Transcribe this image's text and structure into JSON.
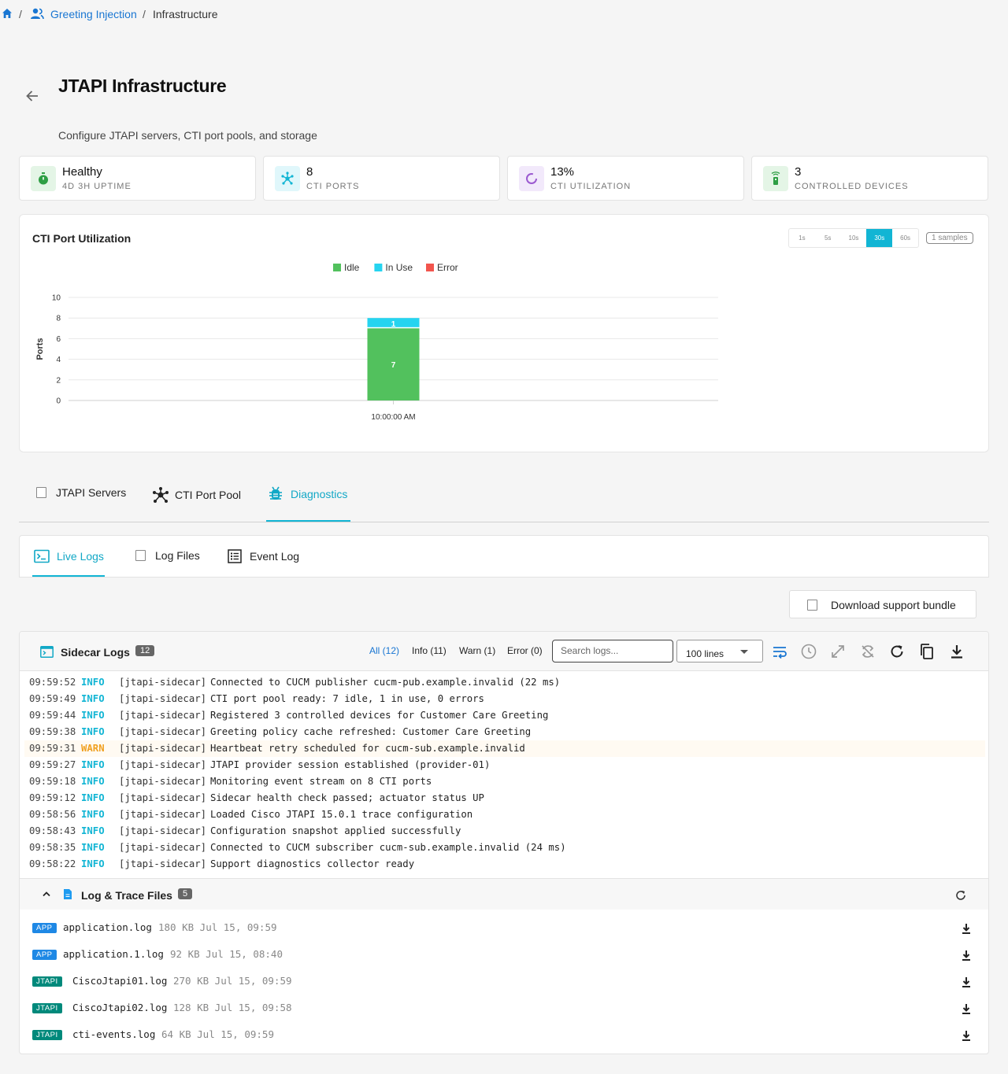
{
  "breadcrumb": {
    "parent": "Greeting Injection",
    "separator": "/",
    "current": "Infrastructure"
  },
  "header": {
    "title": "JTAPI Infrastructure",
    "subtitle": "Configure JTAPI servers, CTI port pools, and storage"
  },
  "stats": [
    {
      "value": "Healthy",
      "label": "4D 3H UPTIME",
      "icon": "stopwatch-icon",
      "color": "#2e9e44"
    },
    {
      "value": "8",
      "label": "CTI PORTS",
      "icon": "hub-icon",
      "color": "#12b5d4"
    },
    {
      "value": "13%",
      "label": "CTI UTILIZATION",
      "icon": "donut-icon",
      "color": "#9b59d0"
    },
    {
      "value": "3",
      "label": "CONTROLLED DEVICES",
      "icon": "phone-signal-icon",
      "color": "#2e9e44"
    }
  ],
  "chart_panel": {
    "title": "CTI Port Utilization",
    "intervals": [
      "1s",
      "5s",
      "10s",
      "30s",
      "60s"
    ],
    "active_interval": "30s",
    "samples": "1 samples"
  },
  "chart_data": {
    "type": "bar",
    "stacked": true,
    "categories": [
      "10:00:00 AM"
    ],
    "series": [
      {
        "name": "Idle",
        "values": [
          7
        ],
        "color": "#52c15d"
      },
      {
        "name": "In Use",
        "values": [
          1
        ],
        "color": "#26d4f0"
      },
      {
        "name": "Error",
        "values": [
          0
        ],
        "color": "#f2554d"
      }
    ],
    "ylabel": "Ports",
    "ylim": [
      0,
      10
    ],
    "yticks": [
      0,
      2,
      4,
      6,
      8,
      10
    ],
    "legend": "top-center",
    "grid": true
  },
  "tabs": [
    {
      "label": "JTAPI Servers",
      "active": false
    },
    {
      "label": "CTI Port Pool",
      "active": false
    },
    {
      "label": "Diagnostics",
      "active": true
    }
  ],
  "subtabs": [
    {
      "label": "Live Logs",
      "active": true
    },
    {
      "label": "Log Files",
      "active": false
    },
    {
      "label": "Event Log",
      "active": false
    }
  ],
  "support_button": "Download support bundle",
  "logs": {
    "title": "Sidecar Logs",
    "count": "12",
    "filters": [
      {
        "label": "All (12)",
        "active": true
      },
      {
        "label": "Info (11)",
        "active": false
      },
      {
        "label": "Warn (1)",
        "active": false
      },
      {
        "label": "Error (0)",
        "active": false
      }
    ],
    "search_placeholder": "Search logs...",
    "lines_select": "100 lines",
    "entries": [
      {
        "time": "09:59:52",
        "level": "INFO",
        "source": "[jtapi-sidecar]",
        "message": "Connected to CUCM publisher cucm-pub.example.invalid (22 ms)"
      },
      {
        "time": "09:59:49",
        "level": "INFO",
        "source": "[jtapi-sidecar]",
        "message": "CTI port pool ready: 7 idle, 1 in use, 0 errors"
      },
      {
        "time": "09:59:44",
        "level": "INFO",
        "source": "[jtapi-sidecar]",
        "message": "Registered 3 controlled devices for Customer Care Greeting"
      },
      {
        "time": "09:59:38",
        "level": "INFO",
        "source": "[jtapi-sidecar]",
        "message": "Greeting policy cache refreshed: Customer Care Greeting"
      },
      {
        "time": "09:59:31",
        "level": "WARN",
        "source": "[jtapi-sidecar]",
        "message": "Heartbeat retry scheduled for cucm-sub.example.invalid"
      },
      {
        "time": "09:59:27",
        "level": "INFO",
        "source": "[jtapi-sidecar]",
        "message": "JTAPI provider session established (provider-01)"
      },
      {
        "time": "09:59:18",
        "level": "INFO",
        "source": "[jtapi-sidecar]",
        "message": "Monitoring event stream on 8 CTI ports"
      },
      {
        "time": "09:59:12",
        "level": "INFO",
        "source": "[jtapi-sidecar]",
        "message": "Sidecar health check passed; actuator status UP"
      },
      {
        "time": "09:58:56",
        "level": "INFO",
        "source": "[jtapi-sidecar]",
        "message": "Loaded Cisco JTAPI 15.0.1 trace configuration"
      },
      {
        "time": "09:58:43",
        "level": "INFO",
        "source": "[jtapi-sidecar]",
        "message": "Configuration snapshot applied successfully"
      },
      {
        "time": "09:58:35",
        "level": "INFO",
        "source": "[jtapi-sidecar]",
        "message": "Connected to CUCM subscriber cucm-sub.example.invalid (24 ms)"
      },
      {
        "time": "09:58:22",
        "level": "INFO",
        "source": "[jtapi-sidecar]",
        "message": "Support diagnostics collector ready"
      }
    ]
  },
  "trace_files": {
    "title": "Log & Trace Files",
    "count": "5",
    "files": [
      {
        "tag": "APP",
        "name": "application.log",
        "meta": "180 KB Jul 15, 09:59"
      },
      {
        "tag": "APP",
        "name": "application.1.log",
        "meta": "92 KB Jul 15, 08:40"
      },
      {
        "tag": "JTAPI",
        "name": "CiscoJtapi01.log",
        "meta": "270 KB Jul 15, 09:59"
      },
      {
        "tag": "JTAPI",
        "name": "CiscoJtapi02.log",
        "meta": "128 KB Jul 15, 09:58"
      },
      {
        "tag": "JTAPI",
        "name": "cti-events.log",
        "meta": "64 KB Jul 15, 09:59"
      }
    ]
  }
}
